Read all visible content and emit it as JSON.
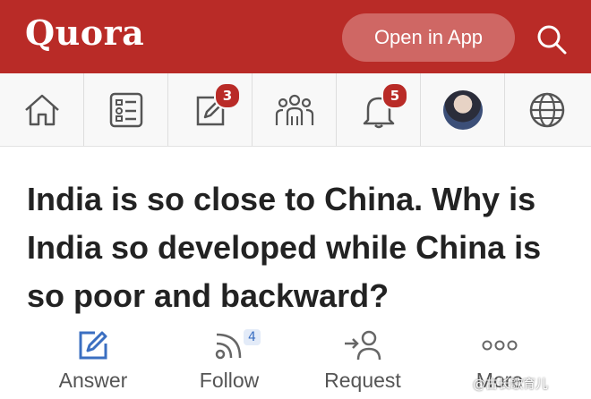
{
  "header": {
    "logo": "Quora",
    "open_app_label": "Open in App",
    "brand_color": "#b92b27"
  },
  "nav": {
    "icons": [
      "home-icon",
      "answer-list-icon",
      "write-icon",
      "spaces-icon",
      "notifications-bell-icon",
      "avatar",
      "language-globe-icon"
    ],
    "write_badge": "3",
    "notification_badge": "5"
  },
  "question": {
    "text": "India is so close to China. Why is India so developed while China is so poor and backward?"
  },
  "actions": {
    "answer_label": "Answer",
    "follow_label": "Follow",
    "follow_count": "4",
    "request_label": "Request",
    "more_label": "More"
  },
  "watermark": "@古长歌育儿"
}
